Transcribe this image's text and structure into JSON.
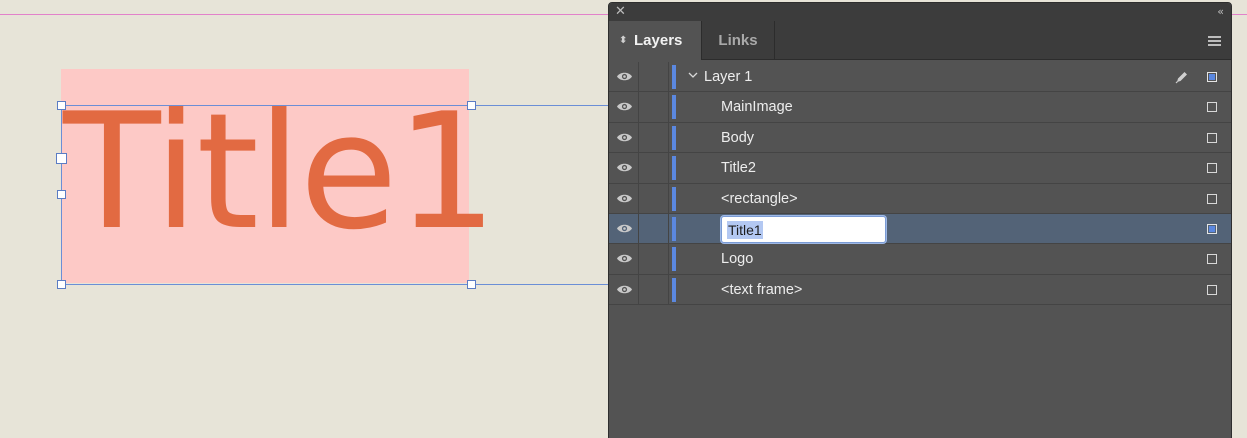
{
  "canvas": {
    "text_frame_content": "Title1"
  },
  "panel": {
    "tabs": [
      {
        "label": "Layers",
        "active": true
      },
      {
        "label": "Links",
        "active": false
      }
    ],
    "layer": {
      "name": "Layer 1",
      "expanded": true,
      "color": "#5b88e0"
    },
    "items": [
      {
        "label": "MainImage"
      },
      {
        "label": "Body"
      },
      {
        "label": "Title2"
      },
      {
        "label": "<rectangle>"
      },
      {
        "label": "Title1",
        "renaming": true
      },
      {
        "label": "Logo"
      },
      {
        "label": "<text frame>"
      }
    ]
  },
  "colors": {
    "canvas_bg": "#e7e4d8",
    "frame_fill": "#fdc9c6",
    "title_text": "#e26a42",
    "selection": "#6b8ed6",
    "panel_bg": "#535353",
    "selected_row": "#536377",
    "layer_color": "#5b88e0"
  },
  "icons": {
    "eye": "eye-icon",
    "close": "close-icon",
    "collapse": "collapse-icon",
    "menu": "panel-menu-icon",
    "pen": "pen-icon",
    "chevron": "chevron-down-icon",
    "sort": "sort-icon"
  }
}
